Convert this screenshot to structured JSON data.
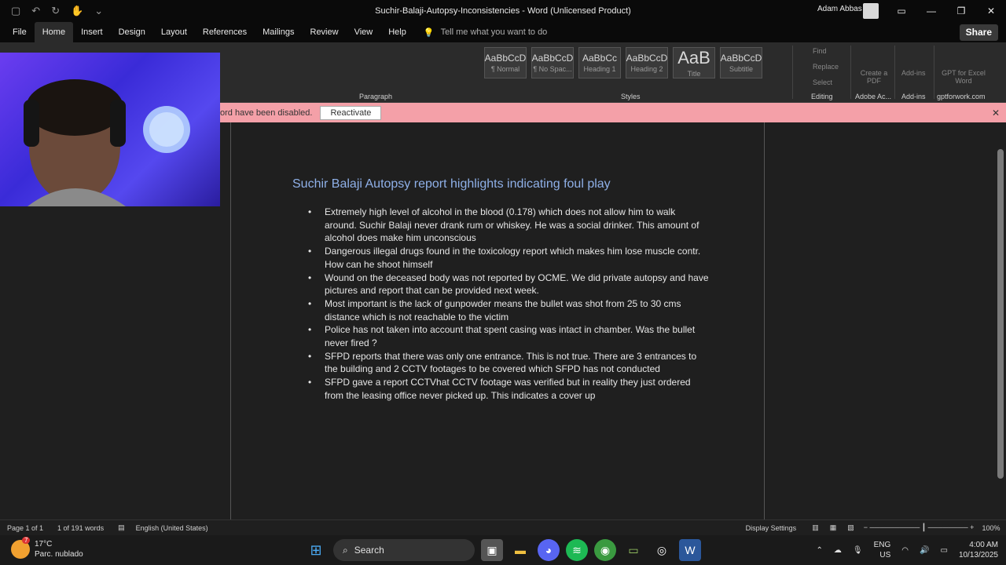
{
  "window": {
    "title": "Suchir-Balaji-Autopsy-Inconsistencies  -  Word (Unlicensed Product)",
    "user": "Adam Abbas"
  },
  "ribbon_tabs": [
    "File",
    "Home",
    "Insert",
    "Design",
    "Layout",
    "References",
    "Mailings",
    "Review",
    "View",
    "Help"
  ],
  "tellme": "Tell me what you want to do",
  "share": "Share",
  "ribbon": {
    "paragraph_label": "Paragraph",
    "styles_label": "Styles",
    "editing_label": "Editing",
    "adobe_label": "Adobe Ac...",
    "addins_label": "Add-ins",
    "gpt_label": "gptforwork.com",
    "styles": [
      {
        "sample": "AaBbCcD",
        "name": "¶ Normal"
      },
      {
        "sample": "AaBbCcD",
        "name": "¶ No Spac..."
      },
      {
        "sample": "AaBbCc",
        "name": "Heading 1"
      },
      {
        "sample": "AaBbCcD",
        "name": "Heading 2"
      },
      {
        "sample": "AaB",
        "name": "Title"
      },
      {
        "sample": "AaBbCcD",
        "name": "Subtitle"
      }
    ],
    "find": "Find",
    "replace": "Replace",
    "select": "Select",
    "create_pdf": "Create a PDF",
    "addins": "Add-ins",
    "gpt": "GPT for Excel Word"
  },
  "infobar": {
    "message": "ord have been disabled.",
    "button": "Reactivate"
  },
  "document": {
    "heading": "Suchir Balaji Autopsy report highlights indicating foul play",
    "bullets": [
      "Extremely high level of alcohol in the blood (0.178) which does not allow him to walk around. Suchir Balaji never drank rum or whiskey. He was a social drinker. This amount of alcohol does make him unconscious",
      "Dangerous illegal drugs found in the toxicology report which makes him lose muscle contr. How can he shoot himself",
      "Wound on the deceased body was not reported by OCME. We did private autopsy and have pictures and report that can be provided next week.",
      "Most important is the lack of gunpowder means the bullet was shot from 25 to 30 cms distance which is not reachable to the victim",
      "Police has not taken into account that spent casing was intact in chamber. Was the bullet never fired ?",
      "SFPD reports that there was only one entrance. This is not true. There are 3 entrances to the building and 2 CCTV  footages to be covered which SFPD has not conducted",
      "SFPD gave a report CCTVhat CCTV footage was verified but in reality they just ordered from the leasing office never picked up. This indicates a cover up"
    ]
  },
  "statusbar": {
    "page": "Page 1 of 1",
    "words": "1 of 191 words",
    "language": "English (United States)",
    "display_settings": "Display Settings",
    "zoom": "100%"
  },
  "taskbar": {
    "temp": "17°C",
    "weather": "Parc. nublado",
    "weather_badge": "7",
    "search": "Search",
    "lang1": "ENG",
    "lang2": "US",
    "time": "4:00 AM",
    "date": "10/13/2025"
  }
}
